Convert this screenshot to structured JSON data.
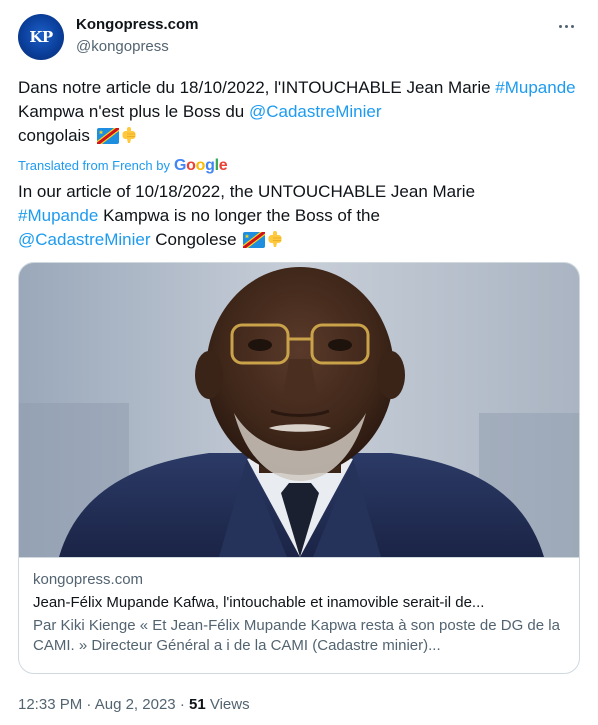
{
  "author": {
    "avatar_text": "KP",
    "display_name": "Kongopress.com",
    "handle": "@kongopress"
  },
  "tweet": {
    "original": {
      "text_1": "Dans notre article du 18/10/2022, l'INTOUCHABLE Jean Marie ",
      "hashtag": "#Mupande",
      "text_2": " Kampwa n'est plus le Boss du ",
      "mention": "@CadastreMinier",
      "text_3": " congolais"
    },
    "translated_label": "Translated from French by",
    "translator_brand": "Google",
    "translation": {
      "text_1": "In our article of 10/18/2022, the UNTOUCHABLE Jean Marie ",
      "hashtag": "#Mupande",
      "text_2": " Kampwa is no longer the Boss of the ",
      "mention": "@CadastreMinier",
      "text_3": " Congolese"
    }
  },
  "card": {
    "domain": "kongopress.com",
    "title": "Jean-Félix Mupande Kafwa, l'intouchable et inamovible serait-il de...",
    "description": "Par Kiki Kienge « Et Jean-Félix Mupande Kapwa resta à son poste de DG de la CAMI. » Directeur Général a i de la CAMI (Cadastre minier)..."
  },
  "meta": {
    "time": "12:33 PM",
    "separator": "·",
    "date": "Aug 2, 2023",
    "views_count": "51",
    "views_label": "Views"
  },
  "colors": {
    "link": "#1d9bf0",
    "secondary_text": "#536471",
    "primary_text": "#0f1419",
    "border": "#cfd9de"
  },
  "icons": {
    "flag": "flag-dr-congo-icon",
    "pointing_down": "backhand-index-pointing-down-icon",
    "more": "more-options-icon"
  }
}
